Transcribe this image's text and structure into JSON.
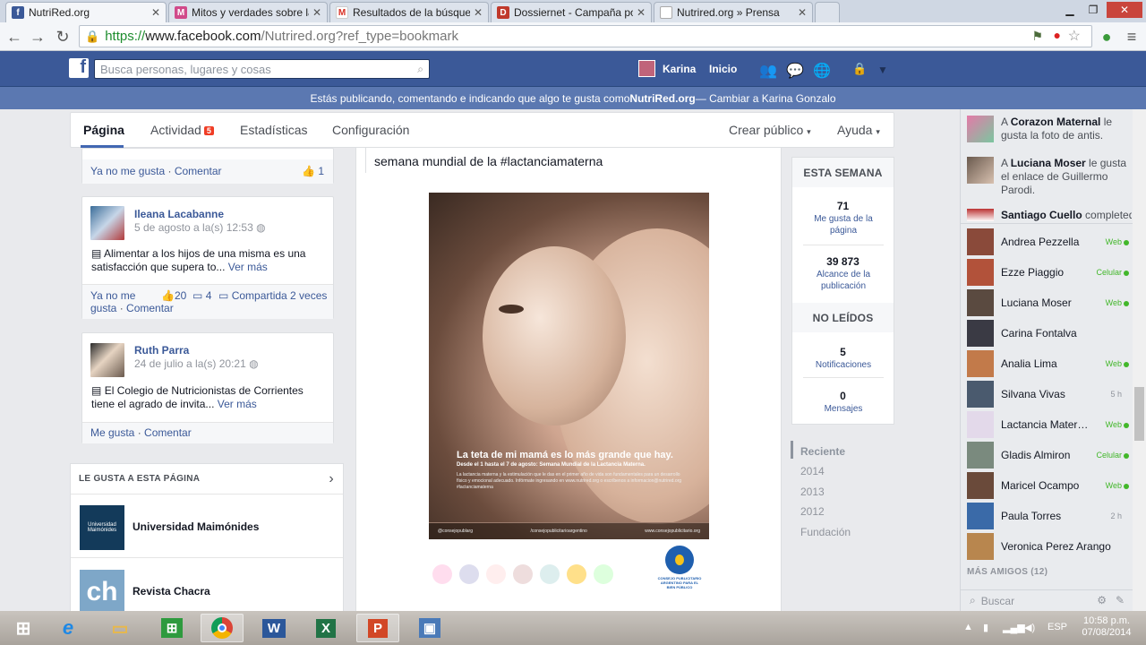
{
  "browser": {
    "tabs": [
      {
        "title": "NutriRed.org",
        "icon": "f",
        "color": "#3b5998"
      },
      {
        "title": "Mitos y verdades sobre la",
        "icon": "M",
        "color": "#d14a8a"
      },
      {
        "title": "Resultados de la búsqueda",
        "icon": "M",
        "color": "#d93025"
      },
      {
        "title": "Dossiernet - Campaña por",
        "icon": "D",
        "color": "#c0392b"
      },
      {
        "title": "Nutrired.org » Prensa",
        "icon": "",
        "color": "#cccccc"
      }
    ],
    "url_scheme": "https://",
    "url_domain": "www.facebook.com",
    "url_path": "/Nutrired.org?ref_type=bookmark"
  },
  "fb": {
    "search_placeholder": "Busca personas, lugares y cosas",
    "user_name": "Karina",
    "home": "Inicio",
    "notice_prefix": "Estás publicando, comentando e indicando que algo te gusta como ",
    "notice_page": "NutriRed.org",
    "notice_suffix": " — Cambiar a Karina Gonzalo"
  },
  "page_tabs": {
    "pagina": "Página",
    "actividad": "Actividad",
    "actividad_badge": "5",
    "estadisticas": "Estadísticas",
    "configuracion": "Configuración",
    "crear_publico": "Crear público",
    "ayuda": "Ayuda"
  },
  "posts": {
    "top_actions": {
      "unlike": "Ya no me gusta",
      "comment": "Comentar",
      "likes": "1"
    },
    "post1": {
      "author": "Ileana Lacabanne",
      "date": "5 de agosto a la(s) 12:53",
      "text": "Alimentar a los hijos de una misma es una satisfacción que supera to...",
      "more": "Ver más",
      "unlike_1": "Ya no me",
      "unlike_2": "gusta",
      "comment": "Comentar",
      "likes": "20",
      "comments": "4",
      "shares": "Compartida 2 veces"
    },
    "post2": {
      "author": "Ruth Parra",
      "date": "24 de julio a la(s) 20:21",
      "text": "El Colegio de Nutricionistas de Corrientes tiene el agrado de invita...",
      "more": "Ver más",
      "like": "Me gusta",
      "comment": "Comentar"
    }
  },
  "likes_box": {
    "title": "LE GUSTA A ESTA PÁGINA",
    "items": [
      {
        "name": "Universidad Maimónides",
        "logo_text": "Universidad Maimónides"
      },
      {
        "name": "Revista Chacra",
        "logo_text": "ch"
      }
    ]
  },
  "feed": {
    "text": "semana mundial de la #lactanciamaterna",
    "ad_headline": "La teta de mi mamá es lo más grande que hay.",
    "ad_subhead": "Desde el 1 hasta el 7 de agosto: Semana Mundial de la Lactancia Materna.",
    "ad_body": "La lactancia materna y la estimulación que le das en el primer año de vida son fundamentales para un desarrollo físico y emocional adecuado. Infórmate ingresando en www.nutrired.org o escríbenos a informacion@nutrired.org #lactanciamaterna",
    "ad_foot_1": "@consejopublarg",
    "ad_foot_2": "/consejopublicitarioargentino",
    "ad_foot_3": "www.consejopublicitario.org",
    "cpa_text": "CONSEJO PUBLICITARIO ARGENTINO PARA EL BIEN PÚBLICO"
  },
  "stats": {
    "week_title": "ESTA SEMANA",
    "likes_num": "71",
    "likes_label": "Me gusta de la página",
    "reach_num": "39 873",
    "reach_label": "Alcance de la publicación",
    "unread_title": "NO LEÍDOS",
    "notif_num": "5",
    "notif_label": "Notificaciones",
    "msg_num": "0",
    "msg_label": "Mensajes"
  },
  "timeline": [
    "Reciente",
    "2014",
    "2013",
    "2012",
    "Fundación"
  ],
  "ticker": [
    {
      "who": "Corazon Maternal",
      "pre": "A ",
      "rest": " le gusta la foto de antis."
    },
    {
      "who": "Luciana Moser",
      "pre": "A ",
      "rest": " le gusta el enlace de Guillermo Parodi."
    },
    {
      "who": "Santiago Cuello",
      "pre": "",
      "rest": " completed"
    }
  ],
  "friends": [
    {
      "name": "Andrea Pezzella",
      "status": "Web",
      "online": true
    },
    {
      "name": "Ezze Piaggio",
      "status": "Celular",
      "online": true
    },
    {
      "name": "Luciana Moser",
      "status": "Web",
      "online": true
    },
    {
      "name": "Carina Fontalva",
      "status": "",
      "online": false
    },
    {
      "name": "Analia Lima",
      "status": "Web",
      "online": true
    },
    {
      "name": "Silvana Vivas",
      "status": "5 h",
      "online": false
    },
    {
      "name": "Lactancia Matern…",
      "status": "Web",
      "online": true
    },
    {
      "name": "Gladis Almiron",
      "status": "Celular",
      "online": true
    },
    {
      "name": "Maricel Ocampo",
      "status": "Web",
      "online": true
    },
    {
      "name": "Paula Torres",
      "status": "2 h",
      "online": false
    },
    {
      "name": "Veronica Perez Arango",
      "status": "",
      "online": false
    }
  ],
  "more_friends": "MÁS AMIGOS (12)",
  "chat_search": "Buscar",
  "taskbar": {
    "lang": "ESP",
    "time": "10:58 p.m.",
    "date": "07/08/2014"
  }
}
